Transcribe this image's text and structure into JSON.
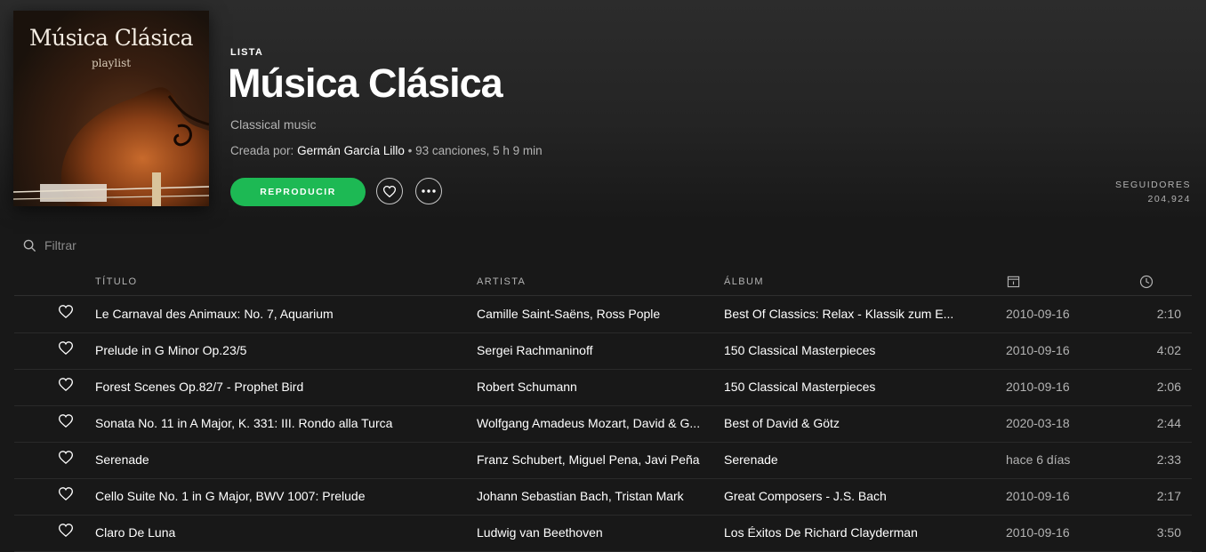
{
  "cover": {
    "title": "Música Clásica",
    "subtitle": "playlist"
  },
  "header": {
    "type_label": "LISTA",
    "title": "Música Clásica",
    "description": "Classical music",
    "created_by_label": "Creada por:",
    "author": "Germán García Lillo",
    "stats": " • 93 canciones, 5 h 9 min"
  },
  "actions": {
    "play_label": "REPRODUCIR",
    "like_icon": "heart-icon",
    "more_icon": "more-icon"
  },
  "followers": {
    "label": "SEGUIDORES",
    "value": "204,924"
  },
  "filter": {
    "placeholder": "Filtrar"
  },
  "table": {
    "columns": {
      "title": "TÍTULO",
      "artist": "ARTISTA",
      "album": "ÁLBUM",
      "date_icon": "calendar-icon",
      "duration_icon": "clock-icon"
    },
    "rows": [
      {
        "title": "Le Carnaval des Animaux: No. 7, Aquarium",
        "artist": "Camille Saint-Saëns, Ross Pople",
        "album": "Best Of Classics: Relax - Klassik zum E...",
        "date": "2010-09-16",
        "duration": "2:10"
      },
      {
        "title": "Prelude in G Minor Op.23/5",
        "artist": "Sergei Rachmaninoff",
        "album": "150 Classical Masterpieces",
        "date": "2010-09-16",
        "duration": "4:02"
      },
      {
        "title": "Forest Scenes Op.82/7 - Prophet Bird",
        "artist": "Robert Schumann",
        "album": "150 Classical Masterpieces",
        "date": "2010-09-16",
        "duration": "2:06"
      },
      {
        "title": "Sonata No. 11 in A Major, K. 331: III. Rondo alla Turca",
        "artist": "Wolfgang Amadeus Mozart, David & G...",
        "album": "Best of David & Götz",
        "date": "2020-03-18",
        "duration": "2:44"
      },
      {
        "title": "Serenade",
        "artist": "Franz Schubert, Miguel Pena, Javi Peña",
        "album": "Serenade",
        "date": "hace 6 días",
        "duration": "2:33"
      },
      {
        "title": "Cello Suite No. 1 in G Major, BWV 1007: Prelude",
        "artist": "Johann Sebastian Bach, Tristan Mark",
        "album": "Great Composers - J.S. Bach",
        "date": "2010-09-16",
        "duration": "2:17"
      },
      {
        "title": "Claro De Luna",
        "artist": "Ludwig van Beethoven",
        "album": "Los Éxitos De Richard Clayderman",
        "date": "2010-09-16",
        "duration": "3:50"
      }
    ]
  },
  "colors": {
    "accent": "#1db954",
    "background": "#181818",
    "muted_text": "#b3b3b3"
  }
}
